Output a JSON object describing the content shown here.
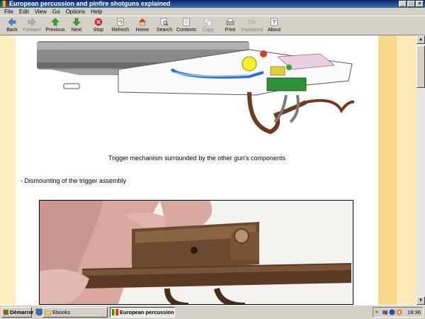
{
  "window": {
    "title": "European percussion and pinfire shotguns explained"
  },
  "menu": [
    "File",
    "Edit",
    "View",
    "Go",
    "Options",
    "Help"
  ],
  "toolbar": {
    "back": "Back",
    "forward": "Forward",
    "previous": "Previous",
    "next": "Next",
    "stop": "Stop",
    "refresh": "Refresh",
    "home": "Home",
    "search": "Search",
    "contents": "Contents",
    "copy": "Copy",
    "print": "Print",
    "password": "Password",
    "about": "About"
  },
  "content": {
    "caption": "Trigger mechanism surrounded by the other gun's components",
    "subheading": "- Dismounting of the trigger assembly"
  },
  "taskbar": {
    "start": "Démarrer",
    "tasks": [
      "Ebooks",
      "European percussion ..."
    ],
    "clock": "18:36"
  },
  "colors": {
    "page_bg": "#ffeebf",
    "stripe": "#f7d88a",
    "titlebar": "#0a246a"
  }
}
